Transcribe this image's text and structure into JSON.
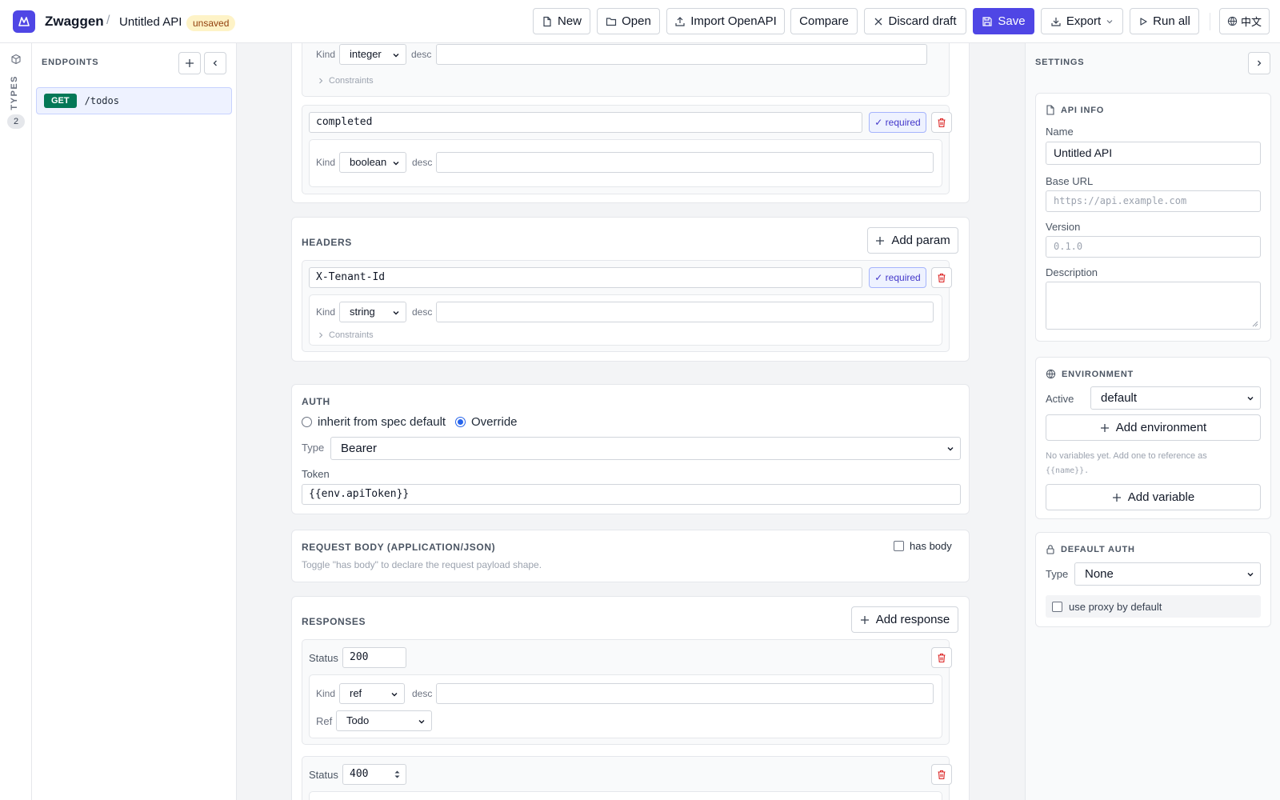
{
  "header": {
    "app_name": "Zwaggen",
    "separator": "/",
    "api_name": "Untitled API",
    "status_badge": "unsaved",
    "buttons": {
      "new": "New",
      "open": "Open",
      "import": "Import OpenAPI",
      "compare": "Compare",
      "discard": "Discard draft",
      "save": "Save",
      "export": "Export",
      "run_all": "Run all",
      "language": "中文"
    }
  },
  "rail": {
    "label": "TYPES",
    "count": "2"
  },
  "sidebar": {
    "title": "ENDPOINTS",
    "endpoints": [
      {
        "method": "GET",
        "path": "/todos"
      }
    ]
  },
  "main": {
    "labels": {
      "kind": "Kind",
      "desc": "desc",
      "constraints": "Constraints",
      "required": "✓ required",
      "status": "Status",
      "ref": "Ref",
      "type": "Type",
      "token": "Token"
    },
    "body_fields": {
      "first_kind": "integer",
      "completed_name": "completed",
      "completed_kind": "boolean"
    },
    "headers": {
      "title": "HEADERS",
      "add_label": "Add param",
      "param_name": "X-Tenant-Id",
      "param_kind": "string"
    },
    "auth": {
      "title": "AUTH",
      "option_inherit": "inherit from spec default",
      "option_override": "Override",
      "type_value": "Bearer",
      "token_value": "{{env.apiToken}}"
    },
    "request_body": {
      "title": "REQUEST BODY (APPLICATION/JSON)",
      "has_body_label": "has body",
      "hint": "Toggle \"has body\" to declare the request payload shape."
    },
    "responses": {
      "title": "RESPONSES",
      "add_label": "Add response",
      "items": [
        {
          "status": "200",
          "kind": "ref",
          "ref": "Todo"
        },
        {
          "status": "400"
        }
      ]
    }
  },
  "settings": {
    "title": "SETTINGS",
    "api_info": {
      "title": "API INFO",
      "name_label": "Name",
      "name_value": "Untitled API",
      "base_url_label": "Base URL",
      "base_url_placeholder": "https://api.example.com",
      "version_label": "Version",
      "version_placeholder": "0.1.0",
      "description_label": "Description"
    },
    "environment": {
      "title": "ENVIRONMENT",
      "active_label": "Active",
      "active_value": "default",
      "add_env_label": "Add environment",
      "hint_line1": "No variables yet. Add one to reference as",
      "hint_line2": "{{name}}.",
      "add_var_label": "Add variable"
    },
    "default_auth": {
      "title": "DEFAULT AUTH",
      "type_label": "Type",
      "type_value": "None",
      "proxy_label": "use proxy by default"
    }
  }
}
